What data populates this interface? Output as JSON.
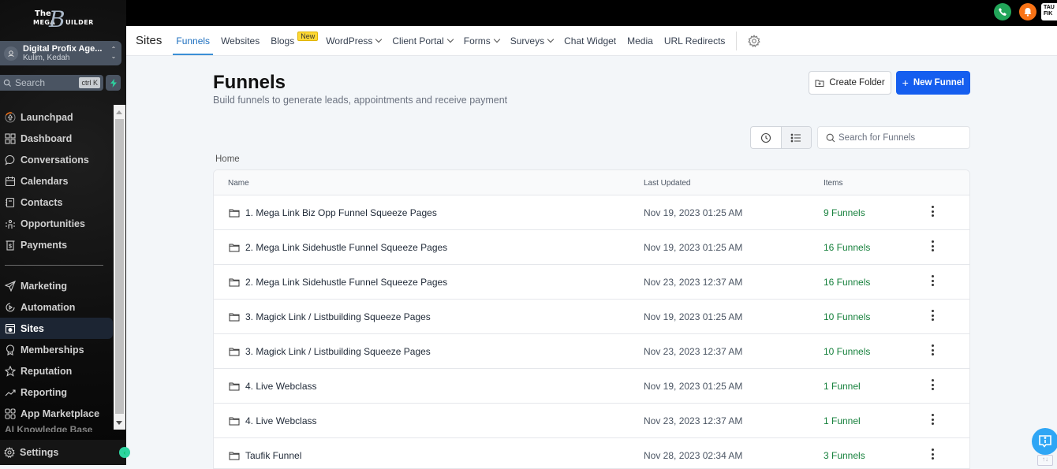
{
  "brand": {
    "the": "The",
    "mega": "MEGA",
    "b": "B",
    "uilder": "UILDER"
  },
  "account": {
    "name": "Digital Profix Age...",
    "location": "Kulim, Kedah"
  },
  "sidebar_search": {
    "label": "Search",
    "shortcut": "ctrl K"
  },
  "sidebar": {
    "items": [
      {
        "label": "Launchpad",
        "icon": "rocket-icon"
      },
      {
        "label": "Dashboard",
        "icon": "grid-icon"
      },
      {
        "label": "Conversations",
        "icon": "chat-icon"
      },
      {
        "label": "Calendars",
        "icon": "calendar-icon"
      },
      {
        "label": "Contacts",
        "icon": "contacts-icon"
      },
      {
        "label": "Opportunities",
        "icon": "opportunities-icon"
      },
      {
        "label": "Payments",
        "icon": "payments-icon"
      }
    ],
    "items2": [
      {
        "label": "Marketing",
        "icon": "send-icon"
      },
      {
        "label": "Automation",
        "icon": "automation-icon"
      },
      {
        "label": "Sites",
        "icon": "sites-icon",
        "active": true
      },
      {
        "label": "Memberships",
        "icon": "award-icon"
      },
      {
        "label": "Reputation",
        "icon": "star-icon"
      },
      {
        "label": "Reporting",
        "icon": "trend-icon"
      },
      {
        "label": "App Marketplace",
        "icon": "apps-icon"
      }
    ],
    "partial_item": "AI Knowledge Base",
    "settings": "Settings"
  },
  "topbar": {
    "avatar_text": "TAU FIK"
  },
  "tabnav": {
    "title": "Sites",
    "tabs": [
      {
        "label": "Funnels",
        "active": true
      },
      {
        "label": "Websites"
      },
      {
        "label": "Blogs",
        "badge": "New"
      },
      {
        "label": "WordPress",
        "dropdown": true
      },
      {
        "label": "Client Portal",
        "dropdown": true
      },
      {
        "label": "Forms",
        "dropdown": true
      },
      {
        "label": "Surveys",
        "dropdown": true
      },
      {
        "label": "Chat Widget"
      },
      {
        "label": "Media"
      },
      {
        "label": "URL Redirects"
      }
    ]
  },
  "page": {
    "title": "Funnels",
    "subtitle": "Build funnels to generate leads, appointments and receive payment",
    "create_folder": "Create Folder",
    "new_funnel": "New Funnel",
    "search_placeholder": "Search for Funnels",
    "breadcrumb": "Home"
  },
  "table": {
    "columns": [
      "Name",
      "Last Updated",
      "Items"
    ],
    "rows": [
      {
        "name": "1. Mega Link Biz Opp Funnel Squeeze Pages",
        "updated": "Nov 19, 2023 01:25 AM",
        "items": "9 Funnels"
      },
      {
        "name": "2. Mega Link Sidehustle Funnel Squeeze Pages",
        "updated": "Nov 19, 2023 01:25 AM",
        "items": "16 Funnels"
      },
      {
        "name": "2. Mega Link Sidehustle Funnel Squeeze Pages",
        "updated": "Nov 23, 2023 12:37 AM",
        "items": "16 Funnels"
      },
      {
        "name": "3. Magick Link / Listbuilding Squeeze Pages",
        "updated": "Nov 19, 2023 01:25 AM",
        "items": "10 Funnels"
      },
      {
        "name": "3. Magick Link / Listbuilding Squeeze Pages",
        "updated": "Nov 23, 2023 12:37 AM",
        "items": "10 Funnels"
      },
      {
        "name": "4. Live Webclass",
        "updated": "Nov 19, 2023 01:25 AM",
        "items": "1 Funnel"
      },
      {
        "name": "4. Live Webclass",
        "updated": "Nov 23, 2023 12:37 AM",
        "items": "1 Funnel"
      },
      {
        "name": "Taufik Funnel",
        "updated": "Nov 28, 2023 02:34 AM",
        "items": "3 Funnels"
      }
    ]
  },
  "colors": {
    "primary": "#155eef",
    "active_tab": "#1d6fbf",
    "items_green": "#16803c",
    "new_badge": "#fdd835",
    "phone": "#22a559",
    "bell": "#f97316",
    "help": "#2fa6f5"
  }
}
